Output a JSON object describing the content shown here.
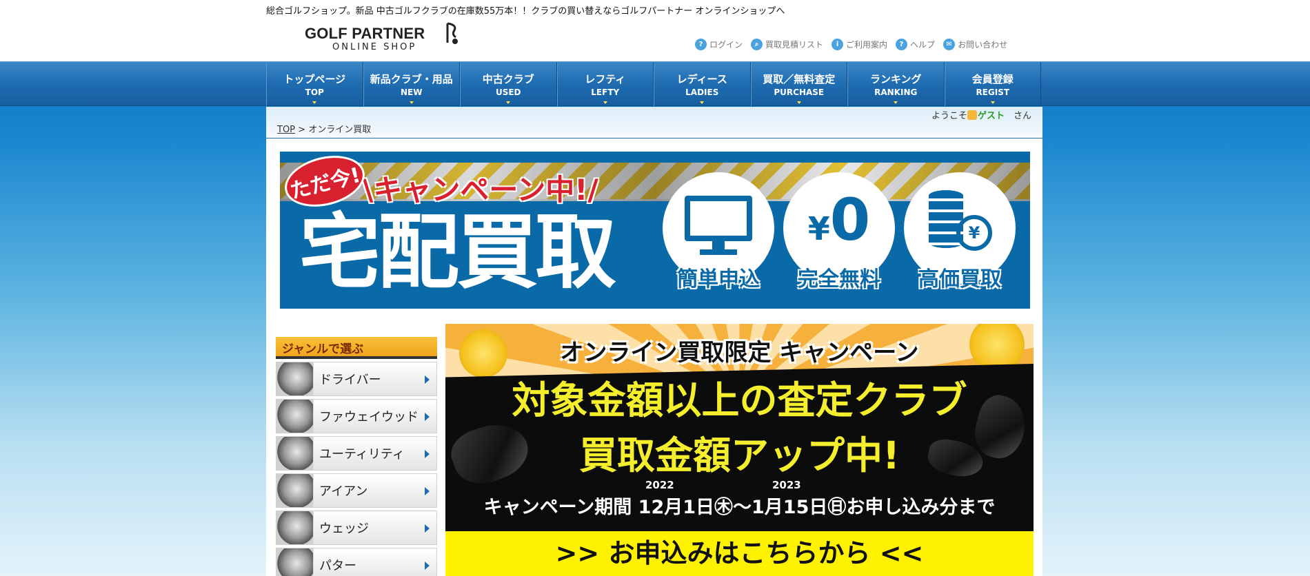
{
  "header": {
    "tagline": "総合ゴルフショップ。新品 中古ゴルフクラブの在庫数55万本！！クラブの買い替えならゴルフパートナー オンラインショップへ",
    "logo_main": "GOLF PARTNER",
    "logo_sub": "ONLINE SHOP",
    "util_links": [
      {
        "label": "ログイン",
        "icon": "key-icon"
      },
      {
        "label": "買取見積リスト",
        "icon": "search-icon"
      },
      {
        "label": "ご利用案内",
        "icon": "info-icon"
      },
      {
        "label": "ヘルプ",
        "icon": "help-icon"
      },
      {
        "label": "お問い合わせ",
        "icon": "mail-icon"
      }
    ]
  },
  "nav": {
    "items": [
      {
        "jp": "トップページ",
        "en": "TOP"
      },
      {
        "jp": "新品クラブ・用品",
        "en": "NEW"
      },
      {
        "jp": "中古クラブ",
        "en": "USED"
      },
      {
        "jp": "レフティ",
        "en": "LEFTY"
      },
      {
        "jp": "レディース",
        "en": "LADIES"
      },
      {
        "jp": "買取／無料査定",
        "en": "PURCHASE"
      },
      {
        "jp": "ランキング",
        "en": "RANKING"
      },
      {
        "jp": "会員登録",
        "en": "REGIST"
      }
    ]
  },
  "welcome": {
    "prefix": "ようこそ",
    "guest": "ゲスト",
    "suffix": "さん"
  },
  "breadcrumb": {
    "top": "TOP",
    "sep": ">",
    "current": "オンライン買取"
  },
  "hero": {
    "badge": "ただ今!",
    "campaign": "\\キャンペーン中!/",
    "title": "宅配買取",
    "yen_symbol": "¥",
    "zero": "0",
    "coin_yen": "¥",
    "features": [
      "簡単申込",
      "完全無料",
      "高価買取"
    ]
  },
  "sidebar": {
    "heading": "ジャンルで選ぶ",
    "items": [
      "ドライバー",
      "ファウェイウッド",
      "ユーティリティ",
      "アイアン",
      "ウェッジ",
      "パター"
    ]
  },
  "promo": {
    "line1": "オンライン買取限定 キャンペーン",
    "line2": "対象金額以上の査定クラブ",
    "line3": "買取金額アップ中!",
    "year_start": "2022",
    "year_end": "2023",
    "period": "キャンペーン期間 12月1日㊍〜1月15日㊐お申し込み分まで",
    "cta": ">> お申込みはこちらから <<"
  }
}
